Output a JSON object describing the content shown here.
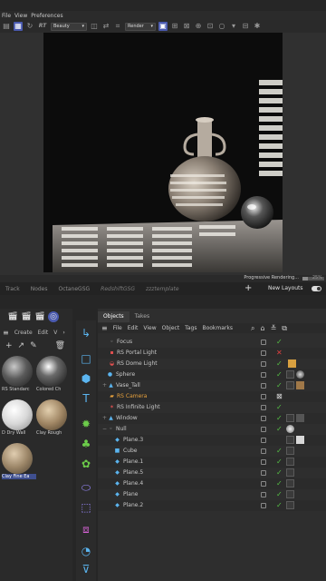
{
  "menubar": {
    "items": [
      "File",
      "View",
      "Preferences"
    ]
  },
  "render_toolbar": {
    "rt_label": "RT",
    "pass_value": "Beauty",
    "render_mode_value": "Render"
  },
  "progress": {
    "label": "Progressive Rendering...",
    "percent_text": "25%",
    "fraction": 0.25
  },
  "layout_tabs": [
    "Track",
    "Nodes",
    "OctaneGSG",
    "RedshiftGSG",
    "zzztemplate"
  ],
  "new_layouts_label": "New Layouts",
  "material_panel": {
    "menu": [
      "Create",
      "Edit",
      "V"
    ],
    "materials": [
      {
        "label": "RS Standarc"
      },
      {
        "label": "Colored Ch"
      },
      {
        "label": "D Dry Wall"
      },
      {
        "label": "Clay Rough"
      },
      {
        "label": "Clay Fine Ea"
      }
    ]
  },
  "objects": {
    "tabs": [
      "Objects",
      "Takes"
    ],
    "menu": [
      "File",
      "Edit",
      "View",
      "Object",
      "Tags",
      "Bookmarks"
    ],
    "rows": [
      {
        "name": "Focus"
      },
      {
        "name": "RS Portal Light"
      },
      {
        "name": "RS Dome Light"
      },
      {
        "name": "Sphere"
      },
      {
        "name": "Vase_Tall"
      },
      {
        "name": "RS Camera"
      },
      {
        "name": "RS Infinite Light"
      },
      {
        "name": "Window"
      },
      {
        "name": "Null"
      },
      {
        "name": "Plane.3"
      },
      {
        "name": "Cube"
      },
      {
        "name": "Plane.1"
      },
      {
        "name": "Plane.5"
      },
      {
        "name": "Plane.4"
      },
      {
        "name": "Plane"
      },
      {
        "name": "Plane.2"
      }
    ]
  }
}
